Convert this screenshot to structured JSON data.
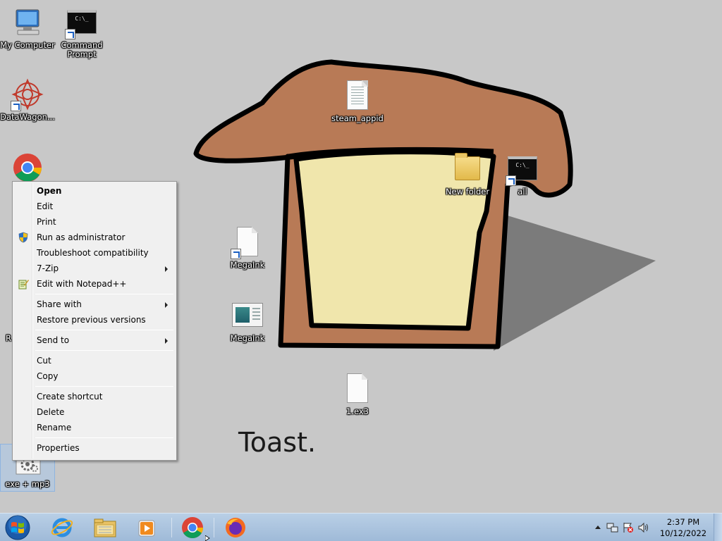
{
  "desktop": {
    "caption": "Toast.",
    "icons": [
      {
        "label": "My Computer",
        "icon": "computer-icon"
      },
      {
        "label": "Command Prompt",
        "icon": "cmd-icon"
      },
      {
        "label": "DataWagon...",
        "icon": "datawagon-icon"
      },
      {
        "label": "steam_appid",
        "icon": "text-file-icon"
      },
      {
        "label": "New folder",
        "icon": "folder-icon"
      },
      {
        "label": "all",
        "icon": "cmd-icon"
      },
      {
        "label": "MegaInk",
        "icon": "file-icon"
      },
      {
        "label": "MegaInk",
        "icon": "image-icon"
      },
      {
        "label": "1.ex3",
        "icon": "file-icon"
      },
      {
        "label": "exe + mp3",
        "icon": "settings-file-icon"
      }
    ],
    "partial_letter": "R"
  },
  "context_menu": {
    "items": [
      {
        "label": "Open",
        "bold": true
      },
      {
        "label": "Edit"
      },
      {
        "label": "Print"
      },
      {
        "label": "Run as administrator",
        "icon": "uac-shield-icon"
      },
      {
        "label": "Troubleshoot compatibility"
      },
      {
        "label": "7-Zip",
        "submenu": true
      },
      {
        "label": "Edit with Notepad++",
        "icon": "notepadpp-icon"
      },
      {
        "label": "Share with",
        "submenu": true
      },
      {
        "label": "Restore previous versions"
      },
      {
        "label": "Send to",
        "submenu": true
      },
      {
        "label": "Cut"
      },
      {
        "label": "Copy"
      },
      {
        "label": "Create shortcut"
      },
      {
        "label": "Delete"
      },
      {
        "label": "Rename"
      },
      {
        "label": "Properties"
      }
    ]
  },
  "taskbar": {
    "pinned": [
      "internet-explorer-icon",
      "windows-explorer-icon",
      "media-player-icon",
      "chrome-icon",
      "firefox-icon"
    ],
    "clock_time": "2:37 PM",
    "clock_date": "10/12/2022",
    "tray_icons": [
      "show-hidden-icons-arrow",
      "network-icon",
      "action-center-icon",
      "volume-icon"
    ]
  },
  "colors": {
    "desktop_bg": "#c8c8c8",
    "toast_crust": "#b87a56",
    "toast_bread": "#f0e6ac",
    "taskbar": "#b2c9e2"
  }
}
